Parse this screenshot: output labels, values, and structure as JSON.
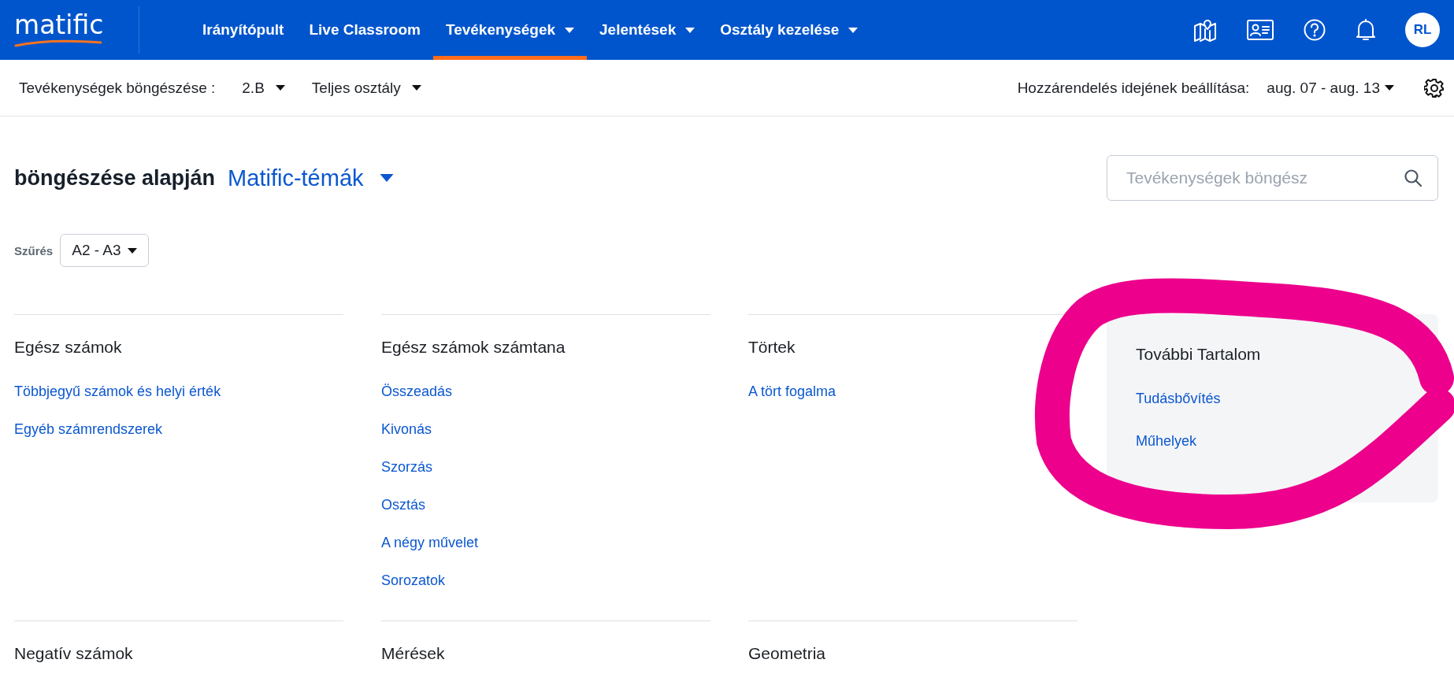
{
  "nav": {
    "logo": "matific",
    "items": [
      {
        "label": "Irányítópult",
        "selected": false,
        "dropdown": false
      },
      {
        "label": "Live Classroom",
        "selected": false,
        "dropdown": false
      },
      {
        "label": "Tevékenységek",
        "selected": true,
        "dropdown": true
      },
      {
        "label": "Jelentések",
        "selected": false,
        "dropdown": true
      },
      {
        "label": "Osztály kezelése",
        "selected": false,
        "dropdown": true
      }
    ],
    "avatar": "RL"
  },
  "toolbar": {
    "browse_label": "Tevékenységek böngészése :",
    "class_name": "2.B",
    "group": "Teljes osztály",
    "assign_label": "Hozzárendelés idejének beállítása:",
    "date_range": "aug. 07 - aug. 13"
  },
  "heading": {
    "text": "böngészése alapján",
    "topic": "Matific-témák"
  },
  "search": {
    "placeholder": "Tevékenységek böngész"
  },
  "filter": {
    "label": "Szűrés",
    "value": "A2 - A3"
  },
  "sections": [
    {
      "title": "Egész számok",
      "links": [
        "Többjegyű számok és helyi érték",
        "Egyéb számrendszerek"
      ]
    },
    {
      "title": "Egész számok számtana",
      "links": [
        "Összeadás",
        "Kivonás",
        "Szorzás",
        "Osztás",
        "A négy művelet",
        "Sorozatok"
      ]
    },
    {
      "title": "Törtek",
      "links": [
        "A tört fogalma"
      ]
    },
    {
      "title": "Negatív számok"
    },
    {
      "title": "Mérések"
    },
    {
      "title": "Geometria"
    }
  ],
  "extra": {
    "title": "További Tartalom",
    "links": [
      "Tudásbővítés",
      "Műhelyek"
    ]
  },
  "annotation": {
    "kind": "scribble"
  }
}
